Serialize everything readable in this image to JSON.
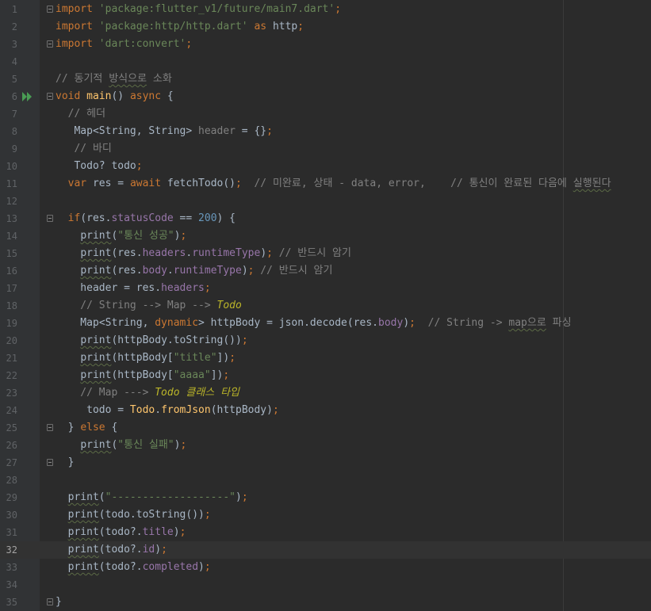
{
  "editor": {
    "current_line": 32,
    "lines": [
      {
        "n": "1",
        "tokens": [
          {
            "t": "import",
            "c": "kw"
          },
          {
            "t": " "
          },
          {
            "t": "'package:flutter_v1/future/main7.dart'",
            "c": "str"
          },
          {
            "t": ";",
            "c": "kw"
          }
        ]
      },
      {
        "n": "2",
        "tokens": [
          {
            "t": "import",
            "c": "kw"
          },
          {
            "t": " "
          },
          {
            "t": "'package:http/http.dart'",
            "c": "str"
          },
          {
            "t": " "
          },
          {
            "t": "as",
            "c": "kw"
          },
          {
            "t": " http"
          },
          {
            "t": ";",
            "c": "kw"
          }
        ]
      },
      {
        "n": "3",
        "tokens": [
          {
            "t": "import",
            "c": "kw"
          },
          {
            "t": " "
          },
          {
            "t": "'dart:convert'",
            "c": "str"
          },
          {
            "t": ";",
            "c": "kw"
          }
        ]
      },
      {
        "n": "4",
        "tokens": []
      },
      {
        "n": "5",
        "tokens": [
          {
            "t": "// 동기적 ",
            "c": "cmt"
          },
          {
            "t": "방식으로",
            "c": "cmt wv"
          },
          {
            "t": " 소화",
            "c": "cmt"
          }
        ]
      },
      {
        "n": "6",
        "tokens": [
          {
            "t": "void",
            "c": "kw"
          },
          {
            "t": " "
          },
          {
            "t": "main",
            "c": "fn"
          },
          {
            "t": "() "
          },
          {
            "t": "async",
            "c": "kw"
          },
          {
            "t": " {"
          }
        ]
      },
      {
        "n": "7",
        "tokens": [
          {
            "t": "  // 헤더",
            "c": "cmt"
          }
        ]
      },
      {
        "n": "8",
        "tokens": [
          {
            "t": "   Map<String, String> "
          },
          {
            "t": "header",
            "c": "cmt"
          },
          {
            "t": " = {}"
          },
          {
            "t": ";",
            "c": "kw"
          }
        ]
      },
      {
        "n": "9",
        "tokens": [
          {
            "t": "   // 바디",
            "c": "cmt"
          }
        ]
      },
      {
        "n": "10",
        "tokens": [
          {
            "t": "   Todo? todo"
          },
          {
            "t": ";",
            "c": "kw"
          }
        ]
      },
      {
        "n": "11",
        "tokens": [
          {
            "t": "  "
          },
          {
            "t": "var",
            "c": "kw"
          },
          {
            "t": " res = "
          },
          {
            "t": "await",
            "c": "kw"
          },
          {
            "t": " fetchTodo()"
          },
          {
            "t": ";",
            "c": "kw"
          },
          {
            "t": "  // 미완료, 상태 - data, error,    // 통신이 완료된 다음에 ",
            "c": "cmt"
          },
          {
            "t": "실행된다",
            "c": "cmt wv"
          }
        ]
      },
      {
        "n": "12",
        "tokens": []
      },
      {
        "n": "13",
        "tokens": [
          {
            "t": "  "
          },
          {
            "t": "if",
            "c": "kw"
          },
          {
            "t": "(res."
          },
          {
            "t": "statusCode",
            "c": "prop"
          },
          {
            "t": " == "
          },
          {
            "t": "200",
            "c": "num"
          },
          {
            "t": ") {"
          }
        ]
      },
      {
        "n": "14",
        "tokens": [
          {
            "t": "    "
          },
          {
            "t": "print",
            "c": "pr"
          },
          {
            "t": "("
          },
          {
            "t": "\"통신 성공\"",
            "c": "str"
          },
          {
            "t": ")"
          },
          {
            "t": ";",
            "c": "kw"
          }
        ]
      },
      {
        "n": "15",
        "tokens": [
          {
            "t": "    "
          },
          {
            "t": "print",
            "c": "pr"
          },
          {
            "t": "(res."
          },
          {
            "t": "headers",
            "c": "prop"
          },
          {
            "t": "."
          },
          {
            "t": "runtimeType",
            "c": "prop"
          },
          {
            "t": ")"
          },
          {
            "t": ";",
            "c": "kw"
          },
          {
            "t": " // 반드시 암기",
            "c": "cmt"
          }
        ]
      },
      {
        "n": "16",
        "tokens": [
          {
            "t": "    "
          },
          {
            "t": "print",
            "c": "pr"
          },
          {
            "t": "(res."
          },
          {
            "t": "body",
            "c": "prop"
          },
          {
            "t": "."
          },
          {
            "t": "runtimeType",
            "c": "prop"
          },
          {
            "t": ")"
          },
          {
            "t": ";",
            "c": "kw"
          },
          {
            "t": " // 반드시 암기",
            "c": "cmt"
          }
        ]
      },
      {
        "n": "17",
        "tokens": [
          {
            "t": "    header = res."
          },
          {
            "t": "headers",
            "c": "prop"
          },
          {
            "t": ";",
            "c": "kw"
          }
        ]
      },
      {
        "n": "18",
        "tokens": [
          {
            "t": "    // String --> Map --> ",
            "c": "cmt"
          },
          {
            "t": "Todo",
            "c": "it"
          }
        ]
      },
      {
        "n": "19",
        "tokens": [
          {
            "t": "    Map<String, "
          },
          {
            "t": "dynamic",
            "c": "dyn"
          },
          {
            "t": "> httpBody = json.decode(res."
          },
          {
            "t": "body",
            "c": "prop"
          },
          {
            "t": ")"
          },
          {
            "t": ";",
            "c": "kw"
          },
          {
            "t": "  // String -> ",
            "c": "cmt"
          },
          {
            "t": "map으로",
            "c": "cmt wv"
          },
          {
            "t": " 파싱",
            "c": "cmt"
          }
        ]
      },
      {
        "n": "20",
        "tokens": [
          {
            "t": "    "
          },
          {
            "t": "print",
            "c": "pr"
          },
          {
            "t": "(httpBody.toString())"
          },
          {
            "t": ";",
            "c": "kw"
          }
        ]
      },
      {
        "n": "21",
        "tokens": [
          {
            "t": "    "
          },
          {
            "t": "print",
            "c": "pr"
          },
          {
            "t": "(httpBody["
          },
          {
            "t": "\"title\"",
            "c": "str"
          },
          {
            "t": "])"
          },
          {
            "t": ";",
            "c": "kw"
          }
        ]
      },
      {
        "n": "22",
        "tokens": [
          {
            "t": "    "
          },
          {
            "t": "print",
            "c": "pr"
          },
          {
            "t": "(httpBody["
          },
          {
            "t": "\"aaaa\"",
            "c": "str"
          },
          {
            "t": "])"
          },
          {
            "t": ";",
            "c": "kw"
          }
        ]
      },
      {
        "n": "23",
        "tokens": [
          {
            "t": "    // Map ---> ",
            "c": "cmt"
          },
          {
            "t": "Todo 클래스 타입",
            "c": "it"
          }
        ]
      },
      {
        "n": "24",
        "tokens": [
          {
            "t": "     todo = "
          },
          {
            "t": "Todo",
            "c": "fn"
          },
          {
            "t": "."
          },
          {
            "t": "fromJson",
            "c": "fn"
          },
          {
            "t": "(httpBody)"
          },
          {
            "t": ";",
            "c": "kw"
          }
        ]
      },
      {
        "n": "25",
        "tokens": [
          {
            "t": "  } "
          },
          {
            "t": "else",
            "c": "kw"
          },
          {
            "t": " {"
          }
        ]
      },
      {
        "n": "26",
        "tokens": [
          {
            "t": "    "
          },
          {
            "t": "print",
            "c": "pr"
          },
          {
            "t": "("
          },
          {
            "t": "\"통신 실패\"",
            "c": "str"
          },
          {
            "t": ")"
          },
          {
            "t": ";",
            "c": "kw"
          }
        ]
      },
      {
        "n": "27",
        "tokens": [
          {
            "t": "  }"
          }
        ]
      },
      {
        "n": "28",
        "tokens": []
      },
      {
        "n": "29",
        "tokens": [
          {
            "t": "  "
          },
          {
            "t": "print",
            "c": "pr"
          },
          {
            "t": "("
          },
          {
            "t": "\"-------------------\"",
            "c": "str"
          },
          {
            "t": ")"
          },
          {
            "t": ";",
            "c": "kw"
          }
        ]
      },
      {
        "n": "30",
        "tokens": [
          {
            "t": "  "
          },
          {
            "t": "print",
            "c": "pr"
          },
          {
            "t": "(todo.toString())"
          },
          {
            "t": ";",
            "c": "kw"
          }
        ]
      },
      {
        "n": "31",
        "tokens": [
          {
            "t": "  "
          },
          {
            "t": "print",
            "c": "pr"
          },
          {
            "t": "(todo?."
          },
          {
            "t": "title",
            "c": "prop"
          },
          {
            "t": ")"
          },
          {
            "t": ";",
            "c": "kw"
          }
        ]
      },
      {
        "n": "32",
        "tokens": [
          {
            "t": "  "
          },
          {
            "t": "print",
            "c": "pr"
          },
          {
            "t": "(todo?."
          },
          {
            "t": "id",
            "c": "prop"
          },
          {
            "t": ")"
          },
          {
            "t": ";",
            "c": "kw"
          }
        ]
      },
      {
        "n": "33",
        "tokens": [
          {
            "t": "  "
          },
          {
            "t": "print",
            "c": "pr"
          },
          {
            "t": "(todo?."
          },
          {
            "t": "completed",
            "c": "prop"
          },
          {
            "t": ")"
          },
          {
            "t": ";",
            "c": "kw"
          }
        ]
      },
      {
        "n": "34",
        "tokens": []
      },
      {
        "n": "35",
        "tokens": [
          {
            "t": "}"
          }
        ]
      }
    ],
    "fold_markers": [
      "1",
      "3",
      "6",
      "13",
      "25",
      "27",
      "35"
    ],
    "run_icon_line": "6",
    "run_icon": "run-arrow-icon",
    "colors": {
      "background": "#2b2b2b",
      "gutter": "#313335",
      "keyword": "#cc7832",
      "string": "#6a8759",
      "comment": "#808080",
      "number": "#6897bb",
      "function": "#ffc66d",
      "property": "#9876aa",
      "run_icon": "#499c54"
    }
  }
}
